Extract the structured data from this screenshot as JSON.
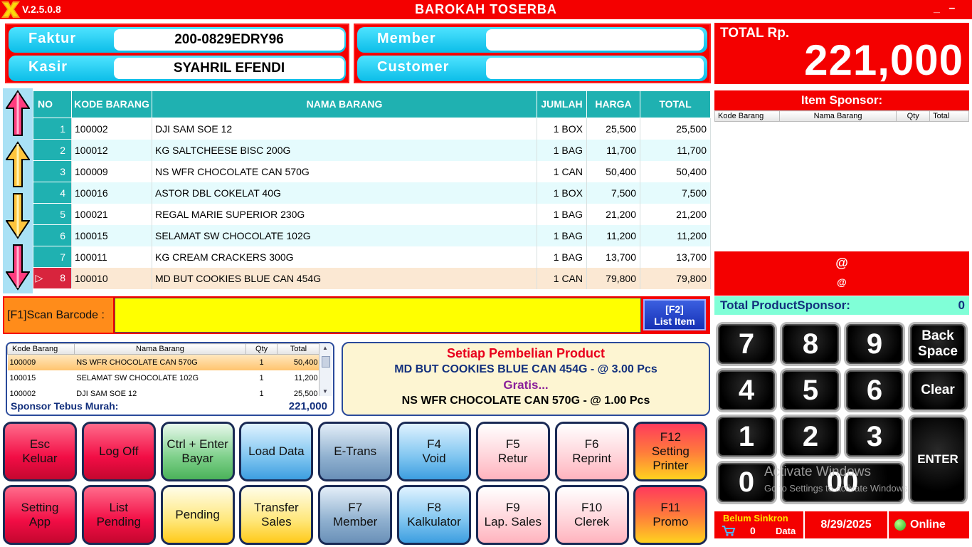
{
  "app": {
    "version": "V.2.5.0.8",
    "title": "BAROKAH  TOSERBA",
    "minimize": "_",
    "close": "–"
  },
  "header": {
    "faktur_label": "Faktur",
    "faktur_value": "200-0829EDRY96",
    "kasir_label": "Kasir",
    "kasir_value": "SYAHRIL EFENDI",
    "member_label": "Member",
    "member_value": "",
    "customer_label": "Customer",
    "customer_value": ""
  },
  "total": {
    "label": "TOTAL Rp.",
    "value": "221,000"
  },
  "grid": {
    "columns": [
      "NO",
      "KODE BARANG",
      "NAMA BARANG",
      "JUMLAH",
      "HARGA",
      "TOTAL"
    ],
    "rows": [
      {
        "no": "1",
        "kode": "100002",
        "nama": "DJI SAM SOE 12",
        "jumlah": "1 BOX",
        "harga": "25,500",
        "total": "25,500"
      },
      {
        "no": "2",
        "kode": "100012",
        "nama": "KG SALTCHEESE BISC 200G",
        "jumlah": "1 BAG",
        "harga": "11,700",
        "total": "11,700"
      },
      {
        "no": "3",
        "kode": "100009",
        "nama": "NS WFR CHOCOLATE CAN 570G",
        "jumlah": "1 CAN",
        "harga": "50,400",
        "total": "50,400"
      },
      {
        "no": "4",
        "kode": "100016",
        "nama": "ASTOR DBL COKELAT 40G",
        "jumlah": "1 BOX",
        "harga": "7,500",
        "total": "7,500"
      },
      {
        "no": "5",
        "kode": "100021",
        "nama": "REGAL MARIE SUPERIOR 230G",
        "jumlah": "1 BAG",
        "harga": "21,200",
        "total": "21,200"
      },
      {
        "no": "6",
        "kode": "100015",
        "nama": "SELAMAT SW CHOCOLATE 102G",
        "jumlah": "1 BAG",
        "harga": "11,200",
        "total": "11,200"
      },
      {
        "no": "7",
        "kode": "100011",
        "nama": "KG CREAM CRACKERS 300G",
        "jumlah": "1 BAG",
        "harga": "13,700",
        "total": "13,700"
      },
      {
        "no": "8",
        "kode": "100010",
        "nama": "MD BUT COOKIES BLUE CAN 454G",
        "jumlah": "1 CAN",
        "harga": "79,800",
        "total": "79,800"
      }
    ]
  },
  "scan": {
    "label": "[F1]Scan Barcode :",
    "value": "",
    "list_button_line1": "[F2]",
    "list_button_line2": "List Item"
  },
  "sponsor_grid": {
    "columns": [
      "Kode Barang",
      "Nama Barang",
      "Qty",
      "Total"
    ],
    "rows": [
      {
        "kode": "100009",
        "nama": "NS WFR CHOCOLATE CAN 570G",
        "qty": "1",
        "total": "50,400"
      },
      {
        "kode": "100015",
        "nama": "SELAMAT SW CHOCOLATE 102G",
        "qty": "1",
        "total": "11,200"
      },
      {
        "kode": "100002",
        "nama": "DJI SAM SOE 12",
        "qty": "1",
        "total": "25,500"
      }
    ],
    "footer_label": "Sponsor Tebus Murah:",
    "footer_value": "221,000"
  },
  "promo": {
    "line1": "Setiap Pembelian Product",
    "line2": "MD BUT COOKIES BLUE CAN 454G - @ 3.00 Pcs",
    "line3": "Gratis...",
    "line4": "NS WFR CHOCOLATE CAN 570G - @ 1.00 Pcs"
  },
  "buttons_row1": [
    {
      "l1": "Esc",
      "l2": "Keluar",
      "style": "red"
    },
    {
      "l1": "Log Off",
      "l2": "",
      "style": "red"
    },
    {
      "l1": "Ctrl + Enter",
      "l2": "Bayar",
      "style": "green"
    },
    {
      "l1": "Load Data",
      "l2": "",
      "style": "blue"
    },
    {
      "l1": "E-Trans",
      "l2": "",
      "style": "grey"
    },
    {
      "l1": "F4",
      "l2": "Void",
      "style": "blue"
    },
    {
      "l1": "F5",
      "l2": "Retur",
      "style": "pink"
    },
    {
      "l1": "F6",
      "l2": "Reprint",
      "style": "pink"
    },
    {
      "l1": "F12",
      "l2": "Setting",
      "l3": "Printer",
      "style": "orange"
    }
  ],
  "buttons_row2": [
    {
      "l1": "Setting",
      "l2": "App",
      "style": "red"
    },
    {
      "l1": "List",
      "l2": "Pending",
      "style": "red"
    },
    {
      "l1": "Pending",
      "l2": "",
      "style": "yellow"
    },
    {
      "l1": "Transfer",
      "l2": "Sales",
      "style": "yellow"
    },
    {
      "l1": "F7",
      "l2": "Member",
      "style": "grey"
    },
    {
      "l1": "F8",
      "l2": "Kalkulator",
      "style": "blue"
    },
    {
      "l1": "F9",
      "l2": "Lap. Sales",
      "style": "pink"
    },
    {
      "l1": "F10",
      "l2": "Clerek",
      "style": "pink"
    },
    {
      "l1": "F11",
      "l2": "Promo",
      "style": "orange"
    }
  ],
  "item_sponsor": {
    "title": "Item Sponsor:",
    "columns": [
      "Kode Barang",
      "Nama Barang",
      "Qty",
      "Total"
    ],
    "at1": "@",
    "at2": "@",
    "total_label": "Total ProductSponsor:",
    "total_value": "0"
  },
  "keypad": {
    "k7": "7",
    "k8": "8",
    "k9": "9",
    "backspace": "Back Space",
    "k4": "4",
    "k5": "5",
    "k6": "6",
    "clear": "Clear",
    "k1": "1",
    "k2": "2",
    "k3": "3",
    "enter": "ENTER",
    "k0": "0",
    "k00": "00"
  },
  "watermark": {
    "line1": "Activate Windows",
    "line2": "Go to Settings to activate Windows."
  },
  "status": {
    "sync_label": "Belum Sinkron",
    "sync_count": "0",
    "sync_data": "Data",
    "date": "8/29/2025",
    "online": "Online"
  }
}
